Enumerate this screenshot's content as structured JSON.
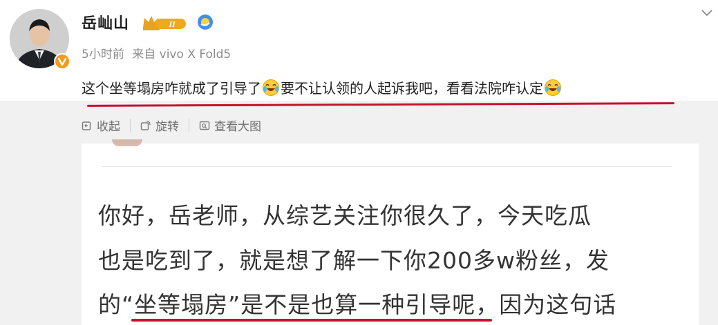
{
  "user": {
    "name": "岳屾山",
    "level_badge": "II",
    "avatar_icon": "person-avatar-icon",
    "verified_badge_icon": "v-verified-icon"
  },
  "meta": {
    "time": "5小时前",
    "source": "来自 vivo X Fold5"
  },
  "post": {
    "text_part1": "这个坐等塌房咋就成了引导了",
    "text_part2": "要不让认领的人起诉我吧，看看法院咋认定",
    "emoji_icon": "laugh-cry-emoji-icon"
  },
  "toolbar": {
    "collapse_label": "收起",
    "rotate_label": "旋转",
    "view_large_label": "查看大图"
  },
  "image_card": {
    "line1": "你好，岳老师，从综艺关注你很久了，今天吃瓜",
    "line2": "也是吃到了，就是想了解一下你200多w粉丝，发",
    "line3": "的“坐等塌房”是不是也算一种引导呢，因为这句话"
  },
  "colors": {
    "accent_red": "#c8102e",
    "badge_gold": "#e9a21b",
    "verify_blue": "#3f8ff7",
    "vip_orange": "#f39a1e"
  }
}
